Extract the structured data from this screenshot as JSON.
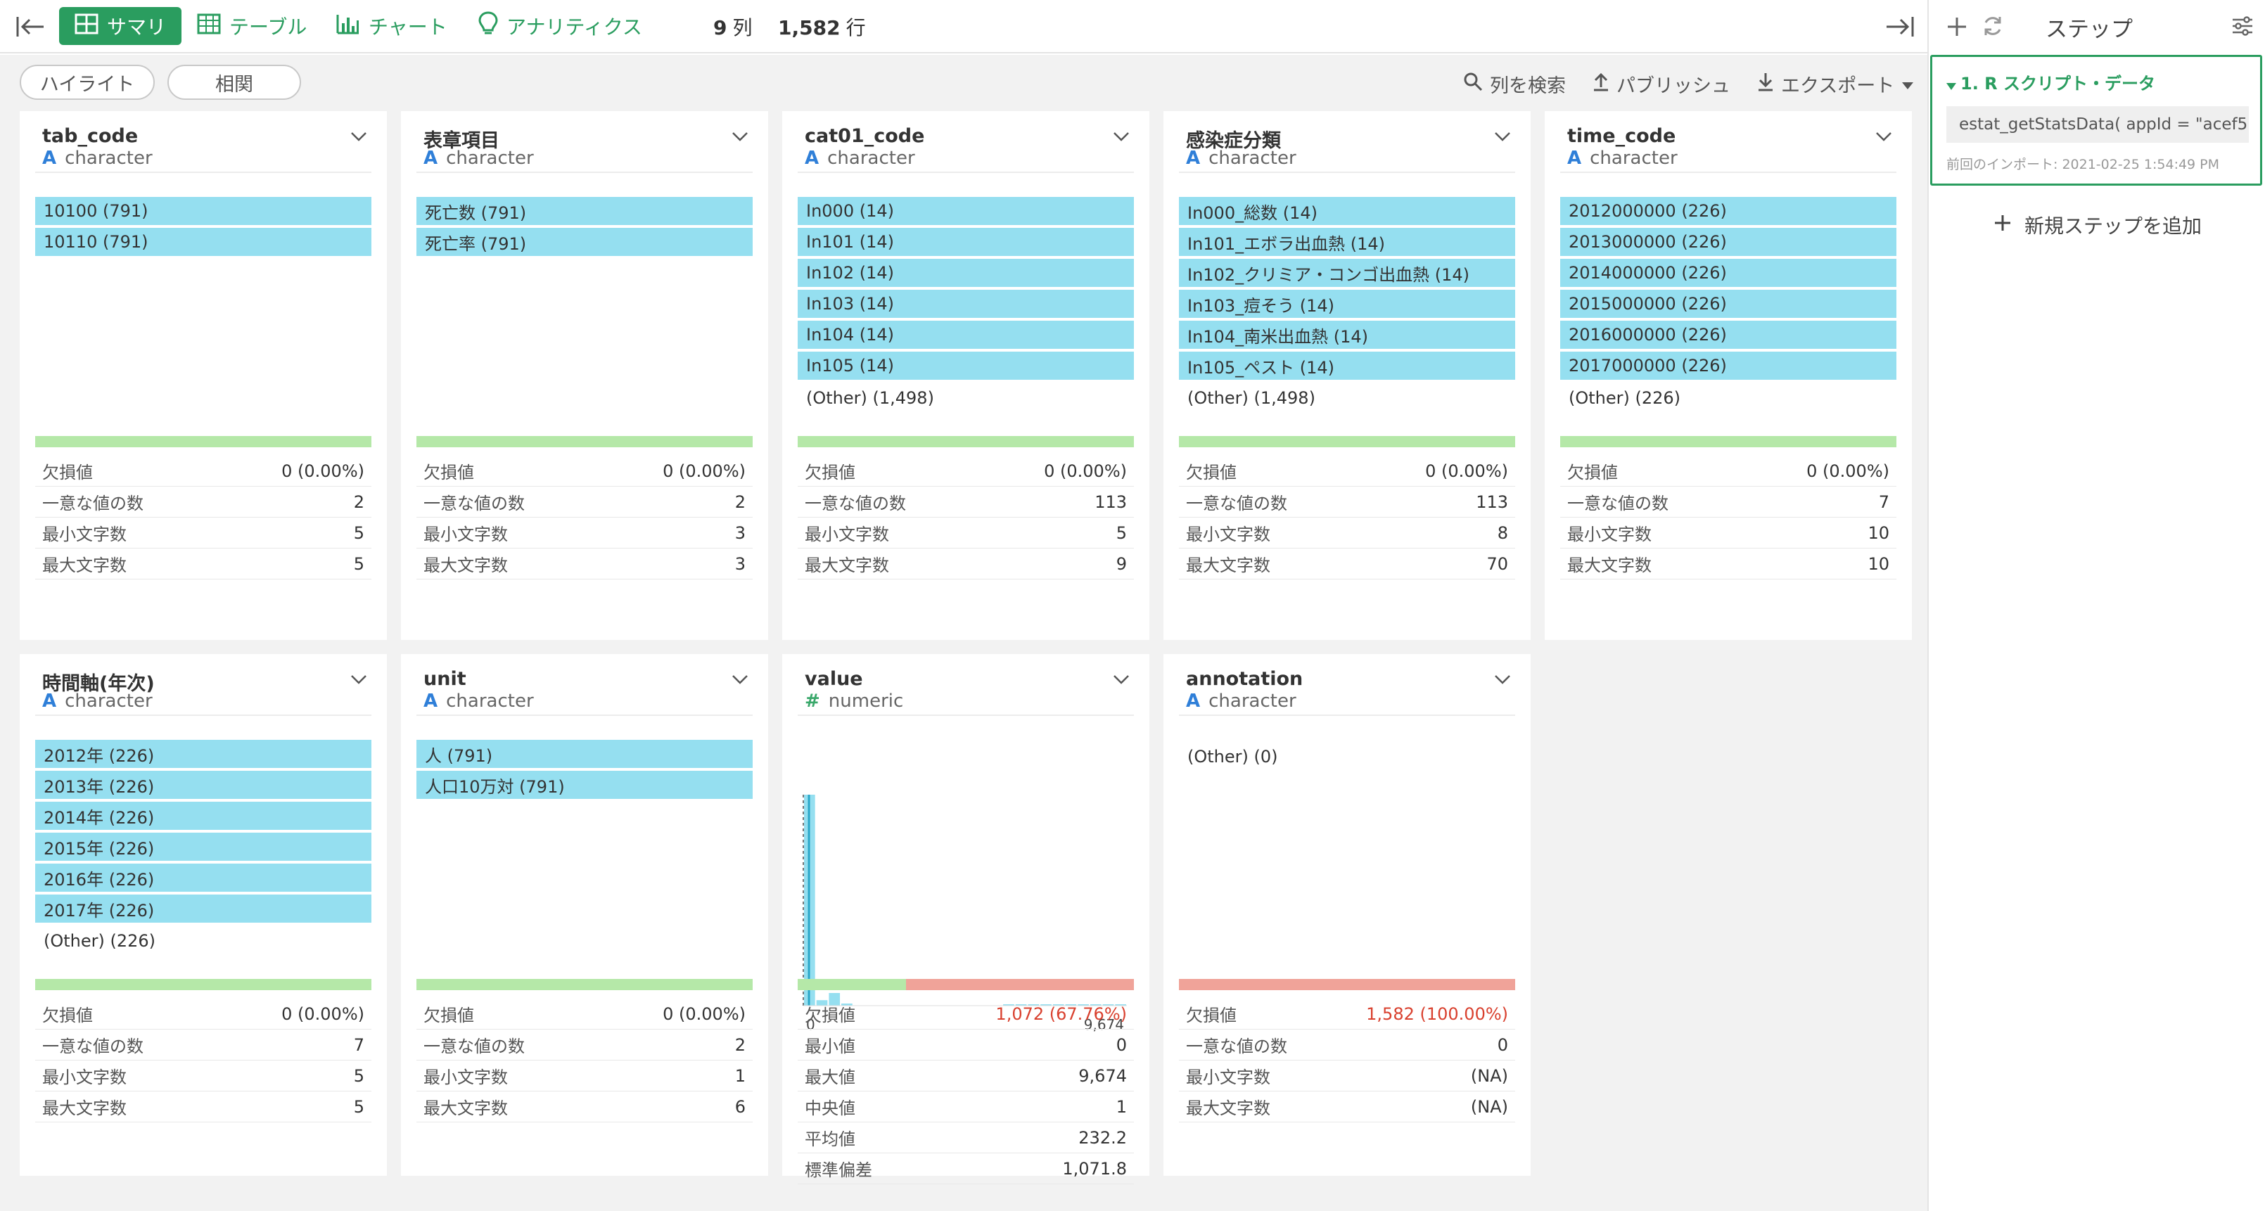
{
  "toolbar": {
    "tabs": [
      {
        "label": "サマリ",
        "icon": "grid-icon"
      },
      {
        "label": "テーブル",
        "icon": "table-icon"
      },
      {
        "label": "チャート",
        "icon": "bar-chart-icon"
      },
      {
        "label": "アナリティクス",
        "icon": "lightbulb-icon"
      }
    ],
    "col_count": "9",
    "col_unit": "列",
    "row_count": "1,582",
    "row_unit": "行"
  },
  "subbar": {
    "highlight": "ハイライト",
    "correlation": "相関",
    "search": "列を検索",
    "publish": "パブリッシュ",
    "export": "エクスポート"
  },
  "columns": [
    {
      "name": "tab_code",
      "type": "character",
      "type_icon": "A",
      "values": [
        "10100 (791)",
        "10110 (791)"
      ],
      "other": "",
      "missing_ratio": 0,
      "stats": [
        [
          "欠損値",
          "0 (0.00%)"
        ],
        [
          "一意な値の数",
          "2"
        ],
        [
          "最小文字数",
          "5"
        ],
        [
          "最大文字数",
          "5"
        ]
      ]
    },
    {
      "name": "表章項目",
      "type": "character",
      "type_icon": "A",
      "values": [
        "死亡数 (791)",
        "死亡率 (791)"
      ],
      "other": "",
      "missing_ratio": 0,
      "stats": [
        [
          "欠損値",
          "0 (0.00%)"
        ],
        [
          "一意な値の数",
          "2"
        ],
        [
          "最小文字数",
          "3"
        ],
        [
          "最大文字数",
          "3"
        ]
      ]
    },
    {
      "name": "cat01_code",
      "type": "character",
      "type_icon": "A",
      "values": [
        "In000 (14)",
        "In101 (14)",
        "In102 (14)",
        "In103 (14)",
        "In104 (14)",
        "In105 (14)"
      ],
      "other": "(Other) (1,498)",
      "missing_ratio": 0,
      "stats": [
        [
          "欠損値",
          "0 (0.00%)"
        ],
        [
          "一意な値の数",
          "113"
        ],
        [
          "最小文字数",
          "5"
        ],
        [
          "最大文字数",
          "9"
        ]
      ]
    },
    {
      "name": "感染症分類",
      "type": "character",
      "type_icon": "A",
      "values": [
        "In000_総数 (14)",
        "In101_エボラ出血熱 (14)",
        "In102_クリミア・コンゴ出血熱 (14)",
        "In103_痘そう (14)",
        "In104_南米出血熱 (14)",
        "In105_ペスト (14)"
      ],
      "other": "(Other) (1,498)",
      "missing_ratio": 0,
      "stats": [
        [
          "欠損値",
          "0 (0.00%)"
        ],
        [
          "一意な値の数",
          "113"
        ],
        [
          "最小文字数",
          "8"
        ],
        [
          "最大文字数",
          "70"
        ]
      ]
    },
    {
      "name": "time_code",
      "type": "character",
      "type_icon": "A",
      "values": [
        "2012000000 (226)",
        "2013000000 (226)",
        "2014000000 (226)",
        "2015000000 (226)",
        "2016000000 (226)",
        "2017000000 (226)"
      ],
      "other": "(Other) (226)",
      "missing_ratio": 0,
      "stats": [
        [
          "欠損値",
          "0 (0.00%)"
        ],
        [
          "一意な値の数",
          "7"
        ],
        [
          "最小文字数",
          "10"
        ],
        [
          "最大文字数",
          "10"
        ]
      ]
    },
    {
      "name": "時間軸(年次)",
      "type": "character",
      "type_icon": "A",
      "values": [
        "2012年 (226)",
        "2013年 (226)",
        "2014年 (226)",
        "2015年 (226)",
        "2016年 (226)",
        "2017年 (226)"
      ],
      "other": "(Other) (226)",
      "missing_ratio": 0,
      "stats": [
        [
          "欠損値",
          "0 (0.00%)"
        ],
        [
          "一意な値の数",
          "7"
        ],
        [
          "最小文字数",
          "5"
        ],
        [
          "最大文字数",
          "5"
        ]
      ]
    },
    {
      "name": "unit",
      "type": "character",
      "type_icon": "A",
      "values": [
        "人 (791)",
        "人口10万対 (791)"
      ],
      "other": "",
      "missing_ratio": 0,
      "stats": [
        [
          "欠損値",
          "0 (0.00%)"
        ],
        [
          "一意な値の数",
          "2"
        ],
        [
          "最小文字数",
          "1"
        ],
        [
          "最大文字数",
          "6"
        ]
      ]
    },
    {
      "name": "value",
      "type": "numeric",
      "type_icon": "#",
      "values": [],
      "other": "",
      "missing_ratio": 0.6776,
      "missing_red": true,
      "stats": [
        [
          "欠損値",
          "1,072 (67.76%)"
        ],
        [
          "最小値",
          "0"
        ],
        [
          "最大値",
          "9,674"
        ],
        [
          "中央値",
          "1"
        ],
        [
          "平均値",
          "232.2"
        ],
        [
          "標準偏差",
          "1,071.8"
        ]
      ]
    },
    {
      "name": "annotation",
      "type": "character",
      "type_icon": "A",
      "values": [],
      "other": "(Other) (0)",
      "missing_ratio": 1.0,
      "missing_red": true,
      "stats": [
        [
          "欠損値",
          "1,582 (100.00%)"
        ],
        [
          "一意な値の数",
          "0"
        ],
        [
          "最小文字数",
          "(NA)"
        ],
        [
          "最大文字数",
          "(NA)"
        ]
      ]
    }
  ],
  "chart_data": {
    "type": "bar",
    "xlim": [
      0,
      9674
    ],
    "tick_labels": [
      "0",
      "9,674"
    ],
    "bins": [
      500,
      13,
      30,
      5,
      0,
      0,
      0,
      0,
      0,
      0,
      0,
      0,
      0,
      0,
      0,
      0,
      3,
      3,
      3,
      3,
      3,
      3,
      3,
      3,
      3,
      3
    ],
    "median": 1,
    "median_line": "dashed"
  },
  "right_panel": {
    "title": "ステップ",
    "step": {
      "name": "1. R スクリプト・データ",
      "code": "estat_getStatsData( appId = \"acef5...",
      "timestamp": "前回のインポート: 2021-02-25 1:54:49 PM"
    },
    "add_step": "新規ステップを追加"
  }
}
